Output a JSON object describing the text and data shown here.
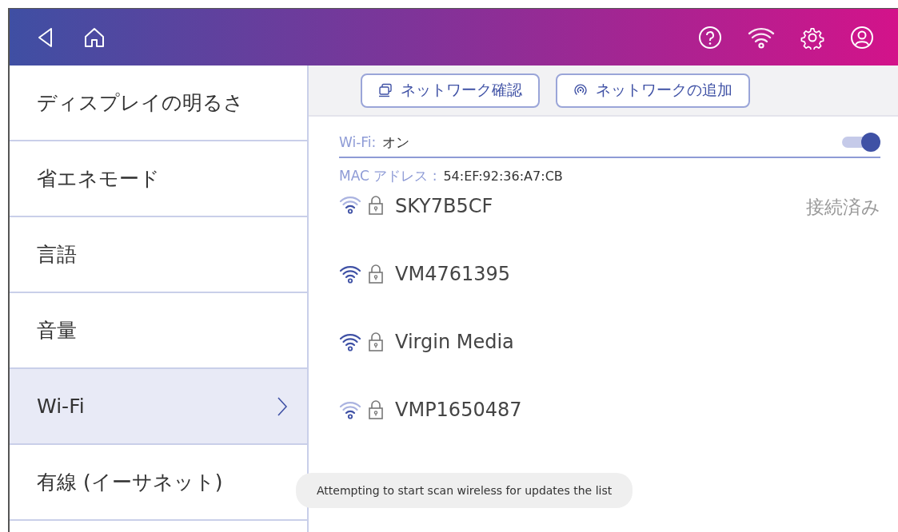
{
  "sidebar": {
    "items": [
      {
        "label": "ディスプレイの明るさ",
        "selected": false
      },
      {
        "label": "省エネモード",
        "selected": false
      },
      {
        "label": "言語",
        "selected": false
      },
      {
        "label": "音量",
        "selected": false
      },
      {
        "label": "Wi-Fi",
        "selected": true
      },
      {
        "label": "有線 (イーサネット)",
        "selected": false
      }
    ]
  },
  "toolbar": {
    "buttons": [
      {
        "kind": "check",
        "label": "ネットワーク確認"
      },
      {
        "kind": "add",
        "label": "ネットワークの追加"
      }
    ]
  },
  "wifi": {
    "label": "Wi-Fi:",
    "value": "オン",
    "on": true
  },
  "mac": {
    "label": "MAC アドレス :",
    "value": "54:EF:92:36:A7:CB"
  },
  "networks": [
    {
      "name": "SKY7B5CF",
      "weak": true,
      "status": "接続済み"
    },
    {
      "name": "VM4761395",
      "weak": false
    },
    {
      "name": "Virgin Media",
      "weak": false
    },
    {
      "name": "VMP1650487",
      "weak": true
    }
  ],
  "toast": {
    "text": "Attempting to start scan wireless for updates the list"
  }
}
